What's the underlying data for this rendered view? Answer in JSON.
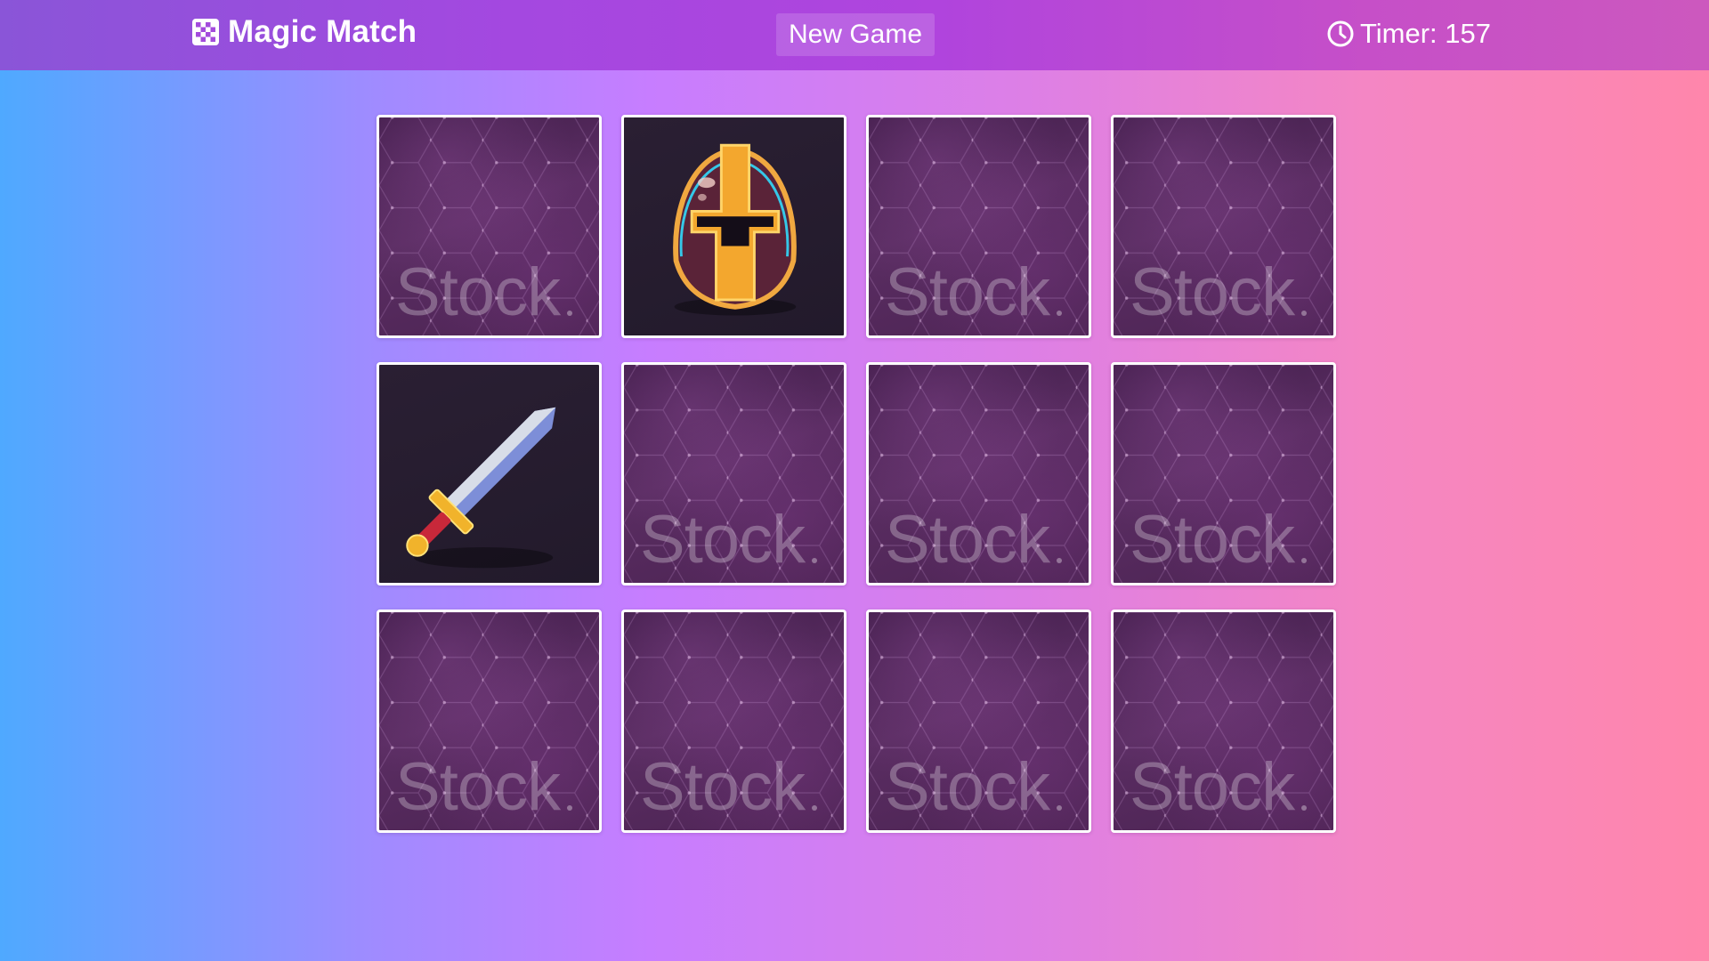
{
  "header": {
    "title": "Magic Match",
    "title_icon": "checkerboard-icon",
    "new_game_label": "New Game",
    "timer_icon": "clock-icon",
    "timer_text": "Timer: 157"
  },
  "board": {
    "rows": 3,
    "cols": 4,
    "card_back_watermark": "Stock",
    "cards": [
      {
        "state": "face-down"
      },
      {
        "state": "face-up",
        "image": "knight-helmet"
      },
      {
        "state": "face-down"
      },
      {
        "state": "face-down"
      },
      {
        "state": "face-up",
        "image": "sword"
      },
      {
        "state": "face-down"
      },
      {
        "state": "face-down"
      },
      {
        "state": "face-down"
      },
      {
        "state": "face-down"
      },
      {
        "state": "face-down"
      },
      {
        "state": "face-down"
      },
      {
        "state": "face-down"
      }
    ]
  },
  "colors": {
    "card_back": "#4a2452",
    "card_face": "#241b2d",
    "card_border": "#ffffff",
    "header_start": "#8a55d8",
    "header_end": "#cc58be"
  }
}
